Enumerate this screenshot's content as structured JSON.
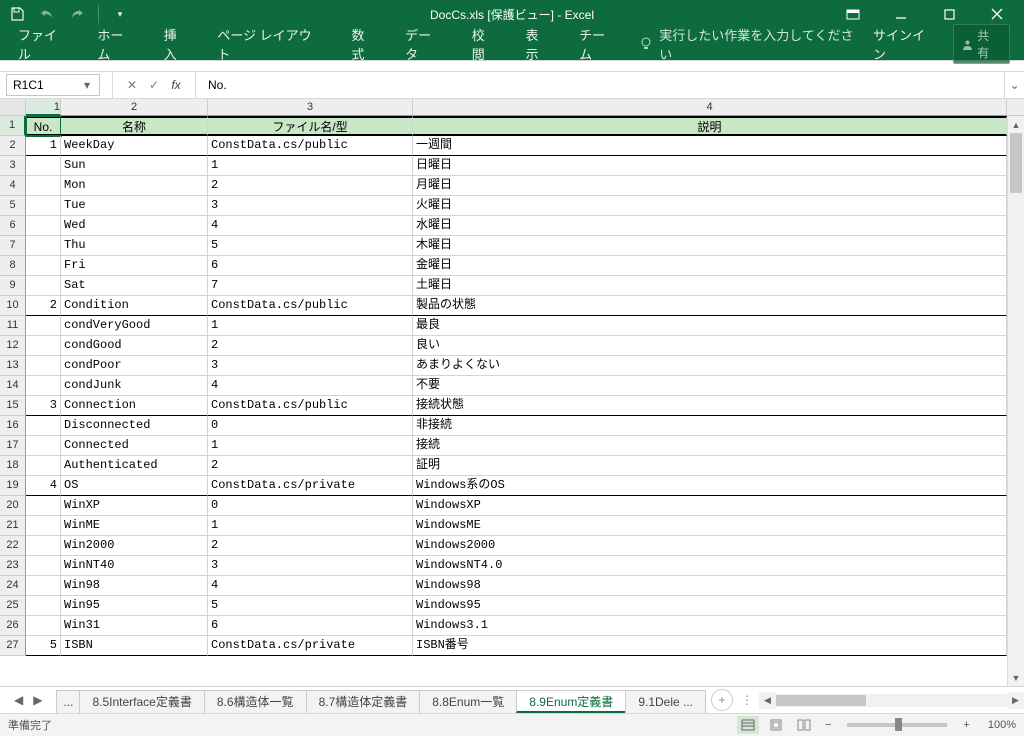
{
  "title": "DocCs.xls  [保護ビュー] - Excel",
  "qat": {
    "customize": "▾"
  },
  "win": {
    "ribbonopts": "▭"
  },
  "ribbon": {
    "tabs": [
      "ファイル",
      "ホーム",
      "挿入",
      "ページ レイアウト",
      "数式",
      "データ",
      "校閲",
      "表示",
      "チーム"
    ],
    "tell": "実行したい作業を入力してください",
    "signin": "サインイン",
    "share": "共有"
  },
  "fbar": {
    "name": "R1C1",
    "formula": "No."
  },
  "cols": [
    "1",
    "2",
    "3",
    "4"
  ],
  "headers": {
    "c1": "No.",
    "c2": "名称",
    "c3": "ファイル名/型",
    "c4": "説明"
  },
  "rows": [
    {
      "n": "1",
      "a": "WeekDay",
      "b": "ConstData.cs/public",
      "c": "一週間",
      "g": true
    },
    {
      "n": "",
      "a": "Sun",
      "b": "1",
      "c": "日曜日"
    },
    {
      "n": "",
      "a": "Mon",
      "b": "2",
      "c": "月曜日"
    },
    {
      "n": "",
      "a": "Tue",
      "b": "3",
      "c": "火曜日"
    },
    {
      "n": "",
      "a": "Wed",
      "b": "4",
      "c": "水曜日"
    },
    {
      "n": "",
      "a": "Thu",
      "b": "5",
      "c": "木曜日"
    },
    {
      "n": "",
      "a": "Fri",
      "b": "6",
      "c": "金曜日"
    },
    {
      "n": "",
      "a": "Sat",
      "b": "7",
      "c": "土曜日"
    },
    {
      "n": "2",
      "a": "Condition",
      "b": "ConstData.cs/public",
      "c": "製品の状態",
      "g": true
    },
    {
      "n": "",
      "a": "condVeryGood",
      "b": "1",
      "c": "最良"
    },
    {
      "n": "",
      "a": "condGood",
      "b": "2",
      "c": "良い"
    },
    {
      "n": "",
      "a": "condPoor",
      "b": "3",
      "c": "あまりよくない"
    },
    {
      "n": "",
      "a": "condJunk",
      "b": "4",
      "c": "不要"
    },
    {
      "n": "3",
      "a": "Connection",
      "b": "ConstData.cs/public",
      "c": "接続状態",
      "g": true
    },
    {
      "n": "",
      "a": "Disconnected",
      "b": "0",
      "c": "非接続"
    },
    {
      "n": "",
      "a": "Connected",
      "b": "1",
      "c": "接続"
    },
    {
      "n": "",
      "a": "Authenticated",
      "b": "2",
      "c": "証明"
    },
    {
      "n": "4",
      "a": "OS",
      "b": "ConstData.cs/private",
      "c": "Windows系のOS",
      "g": true
    },
    {
      "n": "",
      "a": "WinXP",
      "b": "0",
      "c": "WindowsXP"
    },
    {
      "n": "",
      "a": "WinME",
      "b": "1",
      "c": "WindowsME"
    },
    {
      "n": "",
      "a": "Win2000",
      "b": "2",
      "c": "Windows2000"
    },
    {
      "n": "",
      "a": "WinNT40",
      "b": "3",
      "c": "WindowsNT4.0"
    },
    {
      "n": "",
      "a": "Win98",
      "b": "4",
      "c": "Windows98"
    },
    {
      "n": "",
      "a": "Win95",
      "b": "5",
      "c": "Windows95"
    },
    {
      "n": "",
      "a": "Win31",
      "b": "6",
      "c": "Windows3.1"
    },
    {
      "n": "5",
      "a": "ISBN",
      "b": "ConstData.cs/private",
      "c": "ISBN番号",
      "g": true
    }
  ],
  "tabs": {
    "ell": "...",
    "items": [
      "8.5Interface定義書",
      "8.6構造体一覧",
      "8.7構造体定義書",
      "8.8Enum一覧",
      "8.9Enum定義書",
      "9.1Dele ..."
    ],
    "active": 4
  },
  "status": {
    "ready": "準備完了",
    "zoom": "100%"
  }
}
